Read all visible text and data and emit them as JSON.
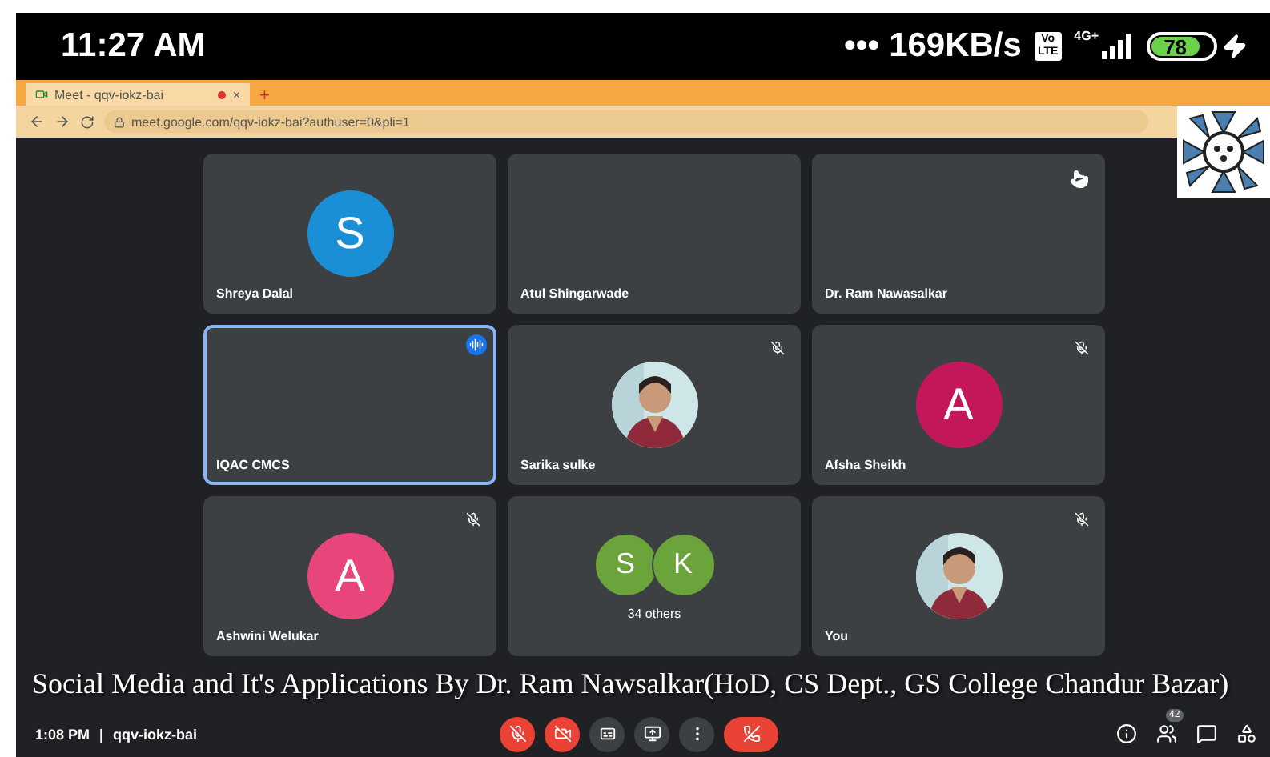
{
  "status_bar": {
    "time": "11:27 AM",
    "dots": "•••",
    "speed": "169KB/s",
    "volte": [
      "Vo",
      "LTE"
    ],
    "network": "4G+",
    "battery": "78"
  },
  "browser": {
    "tab_title": "Meet - qqv-iokz-bai",
    "tab_close": "×",
    "new_tab": "+",
    "url": "meet.google.com/qqv-iokz-bai?authuser=0&pli=1"
  },
  "tiles": [
    {
      "name": "Shreya Dalal",
      "avatar": {
        "kind": "letter",
        "letter": "S",
        "color": "#1a8fd6"
      },
      "muted": false,
      "speaking": false,
      "selected": false
    },
    {
      "name": "Atul Shingarwade",
      "muted": false,
      "speaking": false,
      "selected": false
    },
    {
      "name": "Dr. Ram Nawasalkar",
      "muted": false,
      "speaking": false,
      "selected": false
    },
    {
      "name": "IQAC CMCS",
      "muted": false,
      "speaking": true,
      "selected": true
    },
    {
      "name": "Sarika sulke",
      "muted": true,
      "speaking": false,
      "selected": false
    },
    {
      "name": "Afsha Sheikh",
      "avatar": {
        "kind": "letter",
        "letter": "A",
        "color": "#c2185b"
      },
      "muted": true,
      "speaking": false,
      "selected": false
    },
    {
      "name": "Ashwini Welukar",
      "avatar": {
        "kind": "letter",
        "letter": "A",
        "color": "#e8457a"
      },
      "muted": true,
      "speaking": false,
      "selected": false
    },
    {
      "caption": "34 others",
      "avatar": {
        "kind": "group",
        "letters": [
          "S",
          "K"
        ],
        "color": "#6aa43a"
      },
      "muted": false,
      "speaking": false,
      "selected": false
    },
    {
      "name": "You",
      "muted": true,
      "speaking": false,
      "selected": false
    }
  ],
  "subtitle": "Social Media and It's Applications By  Dr. Ram Nawsalkar(HoD, CS Dept., GS College Chandur Bazar)",
  "meeting_bar": {
    "time": "1:08 PM",
    "separator": "|",
    "code": "qqv-iokz-bai",
    "people_count": "42",
    "controls": [
      {
        "kind": "mic",
        "off": true
      },
      {
        "kind": "camera",
        "off": true
      },
      {
        "kind": "captions",
        "off": false
      },
      {
        "kind": "present",
        "off": false
      },
      {
        "kind": "more",
        "off": false
      },
      {
        "kind": "hangup"
      }
    ]
  }
}
